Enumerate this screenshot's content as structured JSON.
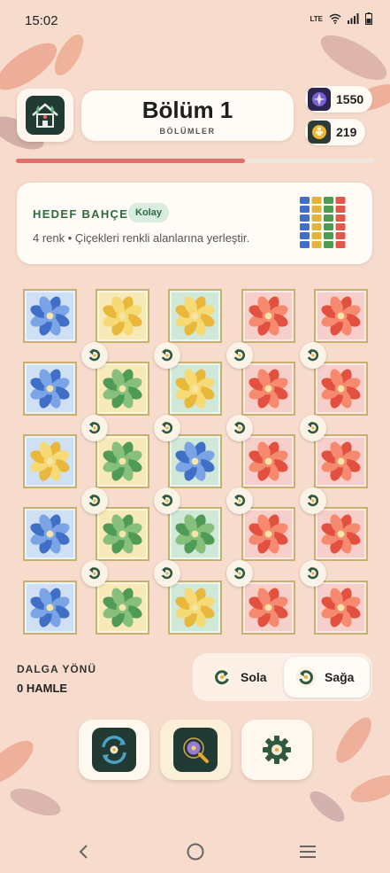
{
  "status_bar": {
    "time": "15:02",
    "network": "LTE"
  },
  "header": {
    "level_title": "Bölüm 1",
    "level_subtitle": "BÖLÜMLER",
    "gems": "1550",
    "keys": "219",
    "progress": 0.64
  },
  "goal": {
    "title": "HEDEF BAHÇE",
    "difficulty": "Kolay",
    "description": "4 renk • Çiçekleri renkli alanlarına yerleştir.",
    "mini_pattern_colors": [
      "#3f6fc7",
      "#e2b33d",
      "#4f9a55",
      "#e05a4c"
    ]
  },
  "colors": {
    "blue": {
      "tile": "#cfe0f5",
      "flower": "#3f6fc7",
      "flower_light": "#7aa4e6"
    },
    "yellow": {
      "tile": "#f8eab8",
      "flower": "#e9b73a",
      "flower_light": "#f6da76"
    },
    "green": {
      "tile": "#cfe8d8",
      "flower": "#4f9a55",
      "flower_light": "#86c07c"
    },
    "red": {
      "tile": "#f7cfca",
      "flower": "#e2503f",
      "flower_light": "#f58a70"
    }
  },
  "board": {
    "rows": [
      {
        "tiles": [
          "blue",
          "yellow",
          "green",
          "red",
          "red"
        ],
        "flowers": [
          "blue",
          "yellow",
          "yellow",
          "red",
          "red"
        ]
      },
      {
        "tiles": [
          "blue",
          "yellow",
          "green",
          "red",
          "red"
        ],
        "flowers": [
          "blue",
          "green",
          "yellow",
          "red",
          "red"
        ]
      },
      {
        "tiles": [
          "blue",
          "yellow",
          "green",
          "red",
          "red"
        ],
        "flowers": [
          "yellow",
          "green",
          "blue",
          "red",
          "red"
        ]
      },
      {
        "tiles": [
          "blue",
          "yellow",
          "green",
          "red",
          "red"
        ],
        "flowers": [
          "blue",
          "green",
          "green",
          "red",
          "red"
        ]
      },
      {
        "tiles": [
          "blue",
          "yellow",
          "green",
          "red",
          "red"
        ],
        "flowers": [
          "blue",
          "green",
          "yellow",
          "red",
          "red"
        ]
      }
    ]
  },
  "bottom": {
    "wave_direction_label": "DALGA YÖNÜ",
    "moves": "0 HAMLE",
    "left_label": "Sola",
    "right_label": "Sağa"
  },
  "icons": {
    "home": "garden-house-icon",
    "gem": "gem-icon",
    "key": "key-icon",
    "rotate": "rotate-icon",
    "shuffle": "shuffle-icon",
    "magnifier": "magnifier-icon",
    "settings": "settings-gear-icon"
  }
}
